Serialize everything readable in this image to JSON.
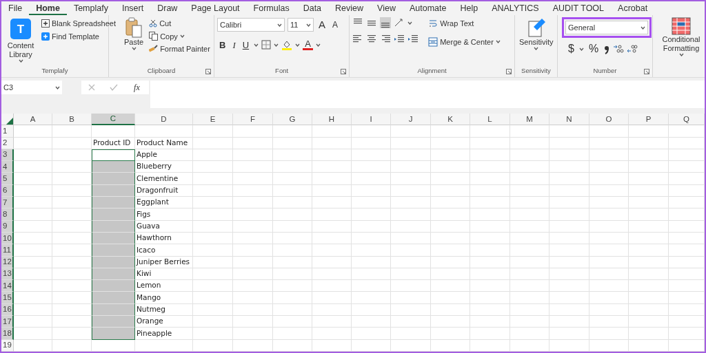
{
  "menu_tabs": [
    {
      "label": "File",
      "selected": false
    },
    {
      "label": "Home",
      "selected": true
    },
    {
      "label": "Templafy",
      "selected": false
    },
    {
      "label": "Insert",
      "selected": false
    },
    {
      "label": "Draw",
      "selected": false
    },
    {
      "label": "Page Layout",
      "selected": false
    },
    {
      "label": "Formulas",
      "selected": false
    },
    {
      "label": "Data",
      "selected": false
    },
    {
      "label": "Review",
      "selected": false
    },
    {
      "label": "View",
      "selected": false
    },
    {
      "label": "Automate",
      "selected": false
    },
    {
      "label": "Help",
      "selected": false
    },
    {
      "label": "ANALYTICS",
      "selected": false
    },
    {
      "label": "AUDIT TOOL",
      "selected": false
    },
    {
      "label": "Acrobat",
      "selected": false
    }
  ],
  "ribbon_groups": [
    {
      "kind": "templafy",
      "label": "Templafy",
      "logo_letter": "T",
      "large_button": "Content Library",
      "items": [
        "Blank Spreadsheet",
        "Find Template"
      ]
    },
    {
      "kind": "clipboard",
      "label": "Clipboard",
      "large_button": "Paste",
      "items": [
        "Cut",
        "Copy",
        "Format Painter"
      ]
    },
    {
      "kind": "font",
      "label": "Font",
      "font_name": "Calibri",
      "font_size": "11",
      "size_buttons": [
        "A",
        "A"
      ],
      "style_buttons": [
        {
          "kind": "bold",
          "label": "B"
        },
        {
          "kind": "italic",
          "label": "I"
        },
        {
          "kind": "underline",
          "label": "U"
        }
      ],
      "font_color_button": "A"
    },
    {
      "kind": "alignment",
      "label": "Alignment",
      "items": [
        "Wrap Text",
        "Merge & Center"
      ]
    },
    {
      "kind": "sensitivity",
      "label": "Sensitivity",
      "large_button": "Sensitivity"
    },
    {
      "kind": "number",
      "label": "Number",
      "format": "General",
      "highlighted": true,
      "symbols": [
        "$",
        "%"
      ]
    },
    {
      "kind": "styles",
      "large_button": "Conditional Formatting"
    }
  ],
  "formula_bar": {
    "name_box": "C3",
    "function_label": "fx"
  },
  "sheet": {
    "columns": [
      {
        "label": "A",
        "selected": false
      },
      {
        "label": "B",
        "selected": false
      },
      {
        "label": "C",
        "selected": true
      },
      {
        "label": "D",
        "selected": false
      },
      {
        "label": "E",
        "selected": false
      },
      {
        "label": "F",
        "selected": false
      },
      {
        "label": "G",
        "selected": false
      },
      {
        "label": "H",
        "selected": false
      },
      {
        "label": "I",
        "selected": false
      },
      {
        "label": "J",
        "selected": false
      },
      {
        "label": "K",
        "selected": false
      },
      {
        "label": "L",
        "selected": false
      },
      {
        "label": "M",
        "selected": false
      },
      {
        "label": "N",
        "selected": false
      },
      {
        "label": "O",
        "selected": false
      },
      {
        "label": "P",
        "selected": false
      },
      {
        "label": "Q",
        "selected": false
      }
    ],
    "rows": [
      {
        "label": "1",
        "selected": false,
        "cells": []
      },
      {
        "label": "2",
        "selected": false,
        "cells": [
          "",
          "",
          "Product ID",
          "Product Name"
        ]
      },
      {
        "label": "3",
        "selected": true,
        "cells": [
          "",
          "",
          "",
          "Apple"
        ]
      },
      {
        "label": "4",
        "selected": true,
        "cells": [
          "",
          "",
          "",
          "Blueberry"
        ]
      },
      {
        "label": "5",
        "selected": true,
        "cells": [
          "",
          "",
          "",
          "Clementine"
        ]
      },
      {
        "label": "6",
        "selected": true,
        "cells": [
          "",
          "",
          "",
          "Dragonfruit"
        ]
      },
      {
        "label": "7",
        "selected": true,
        "cells": [
          "",
          "",
          "",
          "Eggplant"
        ]
      },
      {
        "label": "8",
        "selected": true,
        "cells": [
          "",
          "",
          "",
          "Figs"
        ]
      },
      {
        "label": "9",
        "selected": true,
        "cells": [
          "",
          "",
          "",
          "Guava"
        ]
      },
      {
        "label": "10",
        "selected": true,
        "cells": [
          "",
          "",
          "",
          "Hawthorn"
        ]
      },
      {
        "label": "11",
        "selected": true,
        "cells": [
          "",
          "",
          "",
          "Icaco"
        ]
      },
      {
        "label": "12",
        "selected": true,
        "cells": [
          "",
          "",
          "",
          "Juniper Berries"
        ]
      },
      {
        "label": "13",
        "selected": true,
        "cells": [
          "",
          "",
          "",
          "Kiwi"
        ]
      },
      {
        "label": "14",
        "selected": true,
        "cells": [
          "",
          "",
          "",
          "Lemon"
        ]
      },
      {
        "label": "15",
        "selected": true,
        "cells": [
          "",
          "",
          "",
          "Mango"
        ]
      },
      {
        "label": "16",
        "selected": true,
        "cells": [
          "",
          "",
          "",
          "Nutmeg"
        ]
      },
      {
        "label": "17",
        "selected": true,
        "cells": [
          "",
          "",
          "",
          "Orange"
        ]
      },
      {
        "label": "18",
        "selected": true,
        "cells": [
          "",
          "",
          "",
          "Pineapple"
        ]
      },
      {
        "label": "19",
        "selected": false,
        "cells": []
      }
    ]
  }
}
